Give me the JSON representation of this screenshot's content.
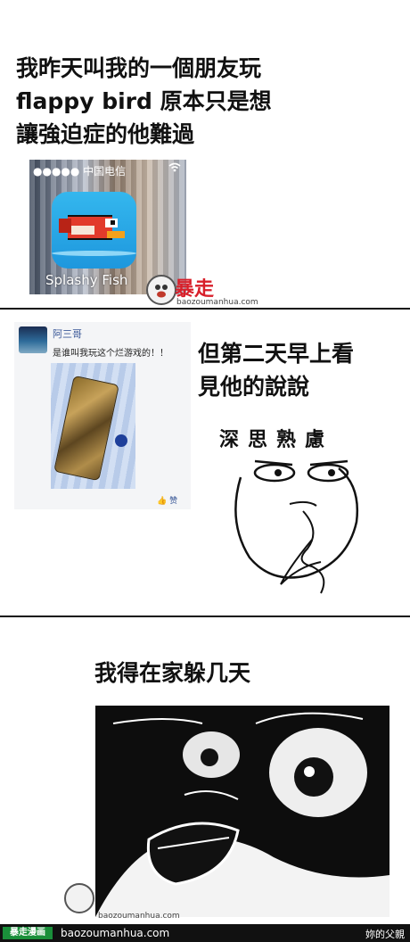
{
  "panel1": {
    "caption_lines": [
      "我昨天叫我的一個朋友玩",
      "flappy bird 原本只是想",
      "讓強迫症的他難過"
    ],
    "screenshot": {
      "status": "●●●●● 中国电信",
      "wifi_icon": "wifi-icon",
      "app_name": "Splashy Fish"
    },
    "watermark_url": "baozoumanhua.com",
    "logo_text": "暴走"
  },
  "panel2": {
    "post": {
      "username": "阿三哥",
      "text": "是谁叫我玩这个烂游戏的！！",
      "like_label": "赞"
    },
    "caption_lines": [
      "但第二天早上看",
      "見他的說說"
    ],
    "face_label": "深思熟慮"
  },
  "panel3": {
    "caption": "我得在家躲几天",
    "watermark_url": "baozoumanhua.com"
  },
  "footer": {
    "badge": "暴走漫画",
    "url": "baozoumanhua.com",
    "right": "妳的父親"
  }
}
